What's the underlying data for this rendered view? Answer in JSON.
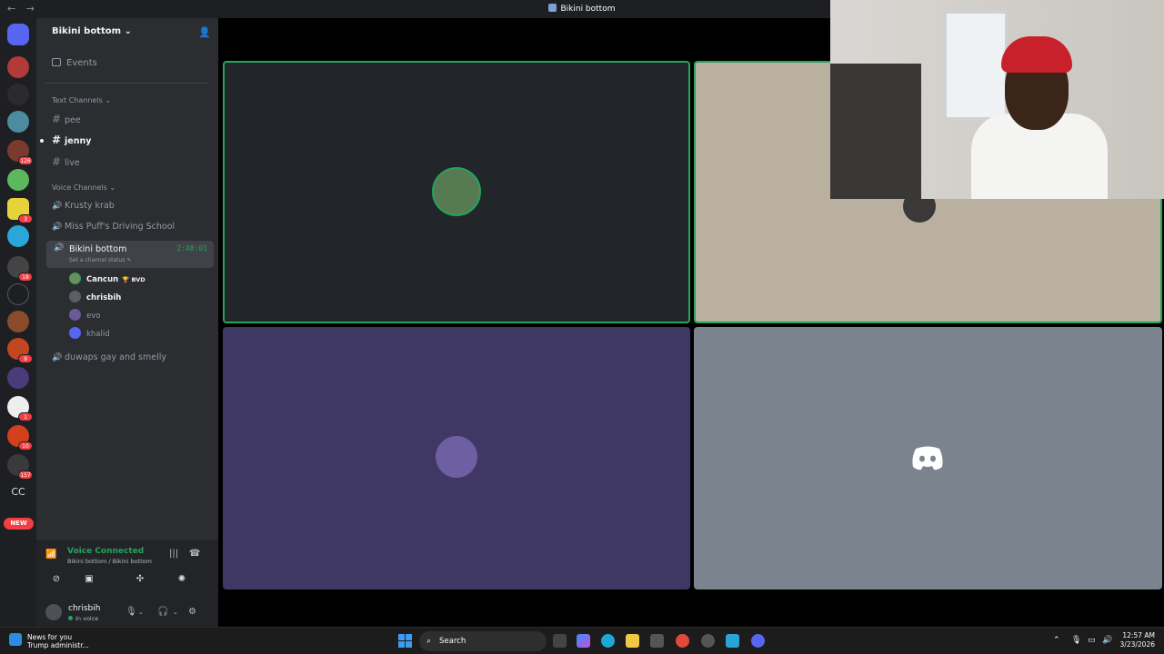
{
  "window": {
    "title": "Bikini bottom",
    "nav": "← →"
  },
  "servers": {
    "badges": [
      "126",
      "3",
      "18",
      "9",
      "1",
      "10",
      "157"
    ],
    "cc_label": "CC",
    "new_label": "NEW"
  },
  "sidebar": {
    "server_name": "Bikini bottom",
    "events_label": "Events",
    "text_category": "Text Channels",
    "text_channels": [
      "pee",
      "jenny",
      "live"
    ],
    "voice_category": "Voice Channels",
    "voice_channels": [
      "Krusty krab",
      "Miss Puff's Driving School",
      "Bikini bottom",
      "duwaps gay and smelly"
    ],
    "active_voice": {
      "name": "Bikini bottom",
      "time": "2:48:01",
      "status": "Set a channel status"
    },
    "members": [
      {
        "name": "Cancun",
        "tag": "🏆 BVD"
      },
      {
        "name": "chrisbih"
      },
      {
        "name": "evo"
      },
      {
        "name": "khalid"
      }
    ]
  },
  "voice_panel": {
    "title": "Voice Connected",
    "subtitle": "Bikini bottom / Bikini bottom"
  },
  "user_panel": {
    "name": "chrisbih",
    "status": "In voice"
  },
  "taskbar": {
    "news_title": "News for you",
    "news_sub": "Trump administr...",
    "search_placeholder": "Search",
    "time": "12:57 AM",
    "date": "3/23/2026"
  },
  "colors": {
    "speaking": "#23a55a",
    "tile_dark": "#222529",
    "tile_beige": "#b9b09f",
    "tile_purple": "#3f3864",
    "tile_gray": "#7a838e"
  }
}
